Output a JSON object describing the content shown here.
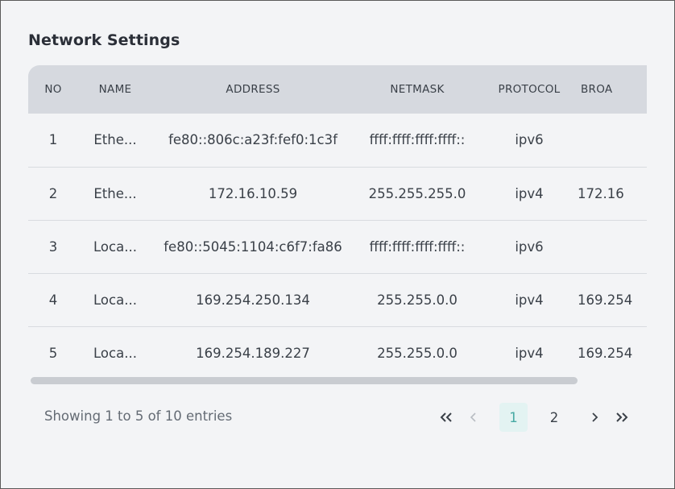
{
  "title": "Network Settings",
  "columns": [
    "NO",
    "NAME",
    "ADDRESS",
    "NETMASK",
    "PROTOCOL",
    "BROA"
  ],
  "rows": [
    {
      "no": "1",
      "name": "Ethe...",
      "address": "fe80::806c:a23f:fef0:1c3f",
      "netmask": "ffff:ffff:ffff:ffff::",
      "protocol": "ipv6",
      "broadcast": ""
    },
    {
      "no": "2",
      "name": "Ethe...",
      "address": "172.16.10.59",
      "netmask": "255.255.255.0",
      "protocol": "ipv4",
      "broadcast": "172.16"
    },
    {
      "no": "3",
      "name": "Loca...",
      "address": "fe80::5045:1104:c6f7:fa86",
      "netmask": "ffff:ffff:ffff:ffff::",
      "protocol": "ipv6",
      "broadcast": ""
    },
    {
      "no": "4",
      "name": "Loca...",
      "address": "169.254.250.134",
      "netmask": "255.255.0.0",
      "protocol": "ipv4",
      "broadcast": "169.254"
    },
    {
      "no": "5",
      "name": "Loca...",
      "address": "169.254.189.227",
      "netmask": "255.255.0.0",
      "protocol": "ipv4",
      "broadcast": "169.254"
    }
  ],
  "footer": {
    "showing": "Showing 1 to 5 of 10 entries"
  },
  "pagination": {
    "pages": [
      "1",
      "2"
    ],
    "current": "1"
  },
  "colors": {
    "background": "#f3f4f6",
    "header_bg": "#d6d9df",
    "active_page_bg": "#e3f3f2",
    "active_page_text": "#46a9a3"
  },
  "icons": [
    "double-chevron-left-icon",
    "chevron-left-icon",
    "chevron-right-icon",
    "double-chevron-right-icon"
  ]
}
